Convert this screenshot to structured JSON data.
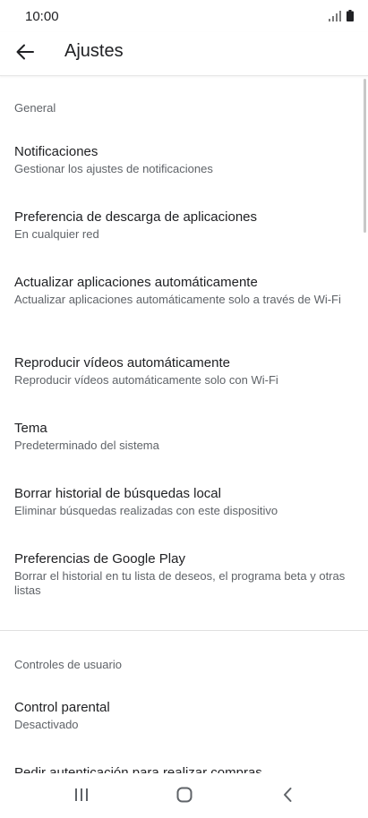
{
  "status_bar": {
    "time": "10:00",
    "icons": [
      "signal-icon",
      "battery-icon"
    ]
  },
  "app_bar": {
    "back_icon": "arrow-back-icon",
    "title": "Ajustes"
  },
  "sections": {
    "general": {
      "header": "General",
      "items": [
        {
          "title": "Notificaciones",
          "subtitle": "Gestionar los ajustes de notificaciones"
        },
        {
          "title": "Preferencia de descarga de aplicaciones",
          "subtitle": "En cualquier red"
        },
        {
          "title": "Actualizar aplicaciones automáticamente",
          "subtitle": "Actualizar aplicaciones automáticamente solo a través de Wi-Fi"
        },
        {
          "title": "Reproducir vídeos automáticamente",
          "subtitle": "Reproducir vídeos automáticamente solo con Wi-Fi"
        },
        {
          "title": "Tema",
          "subtitle": "Predeterminado del sistema"
        },
        {
          "title": "Borrar historial de búsquedas local",
          "subtitle": "Eliminar búsquedas realizadas con este dispositivo"
        },
        {
          "title": "Preferencias de Google Play",
          "subtitle": "Borrar el historial en tu lista de deseos, el programa beta y otras listas"
        }
      ]
    },
    "user_controls": {
      "header": "Controles de usuario",
      "items": [
        {
          "title": "Control parental",
          "subtitle": "Desactivado"
        },
        {
          "title": "Pedir autenticación para realizar compras",
          "subtitle": ""
        }
      ]
    }
  },
  "nav_bar": {
    "icons": [
      "recent-apps-icon",
      "home-icon",
      "back-nav-icon"
    ]
  },
  "colors": {
    "primary_text": "#202124",
    "secondary_text": "#5f6368",
    "divider": "#e0e0e0"
  }
}
